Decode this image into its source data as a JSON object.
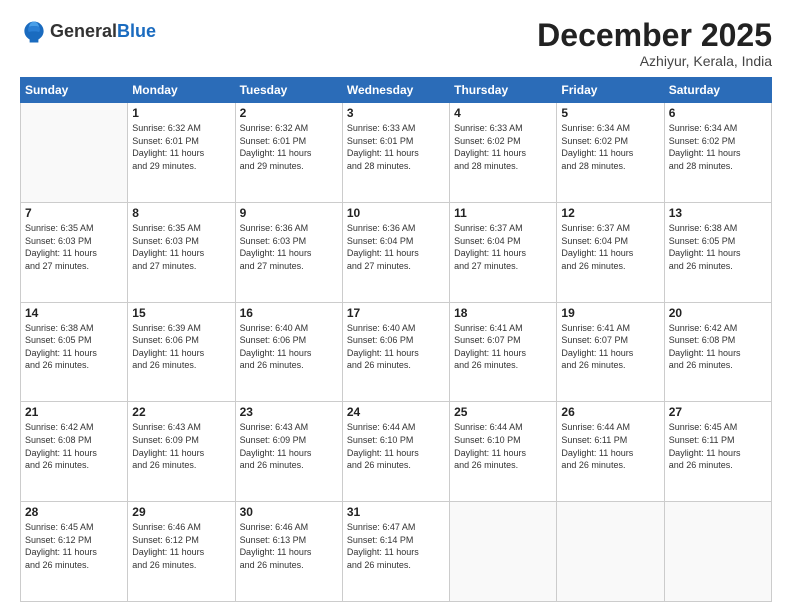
{
  "logo": {
    "general": "General",
    "blue": "Blue"
  },
  "header": {
    "month": "December 2025",
    "location": "Azhiyur, Kerala, India"
  },
  "weekdays": [
    "Sunday",
    "Monday",
    "Tuesday",
    "Wednesday",
    "Thursday",
    "Friday",
    "Saturday"
  ],
  "weeks": [
    [
      {
        "day": "",
        "info": ""
      },
      {
        "day": "1",
        "info": "Sunrise: 6:32 AM\nSunset: 6:01 PM\nDaylight: 11 hours\nand 29 minutes."
      },
      {
        "day": "2",
        "info": "Sunrise: 6:32 AM\nSunset: 6:01 PM\nDaylight: 11 hours\nand 29 minutes."
      },
      {
        "day": "3",
        "info": "Sunrise: 6:33 AM\nSunset: 6:01 PM\nDaylight: 11 hours\nand 28 minutes."
      },
      {
        "day": "4",
        "info": "Sunrise: 6:33 AM\nSunset: 6:02 PM\nDaylight: 11 hours\nand 28 minutes."
      },
      {
        "day": "5",
        "info": "Sunrise: 6:34 AM\nSunset: 6:02 PM\nDaylight: 11 hours\nand 28 minutes."
      },
      {
        "day": "6",
        "info": "Sunrise: 6:34 AM\nSunset: 6:02 PM\nDaylight: 11 hours\nand 28 minutes."
      }
    ],
    [
      {
        "day": "7",
        "info": "Sunrise: 6:35 AM\nSunset: 6:03 PM\nDaylight: 11 hours\nand 27 minutes."
      },
      {
        "day": "8",
        "info": "Sunrise: 6:35 AM\nSunset: 6:03 PM\nDaylight: 11 hours\nand 27 minutes."
      },
      {
        "day": "9",
        "info": "Sunrise: 6:36 AM\nSunset: 6:03 PM\nDaylight: 11 hours\nand 27 minutes."
      },
      {
        "day": "10",
        "info": "Sunrise: 6:36 AM\nSunset: 6:04 PM\nDaylight: 11 hours\nand 27 minutes."
      },
      {
        "day": "11",
        "info": "Sunrise: 6:37 AM\nSunset: 6:04 PM\nDaylight: 11 hours\nand 27 minutes."
      },
      {
        "day": "12",
        "info": "Sunrise: 6:37 AM\nSunset: 6:04 PM\nDaylight: 11 hours\nand 26 minutes."
      },
      {
        "day": "13",
        "info": "Sunrise: 6:38 AM\nSunset: 6:05 PM\nDaylight: 11 hours\nand 26 minutes."
      }
    ],
    [
      {
        "day": "14",
        "info": "Sunrise: 6:38 AM\nSunset: 6:05 PM\nDaylight: 11 hours\nand 26 minutes."
      },
      {
        "day": "15",
        "info": "Sunrise: 6:39 AM\nSunset: 6:06 PM\nDaylight: 11 hours\nand 26 minutes."
      },
      {
        "day": "16",
        "info": "Sunrise: 6:40 AM\nSunset: 6:06 PM\nDaylight: 11 hours\nand 26 minutes."
      },
      {
        "day": "17",
        "info": "Sunrise: 6:40 AM\nSunset: 6:06 PM\nDaylight: 11 hours\nand 26 minutes."
      },
      {
        "day": "18",
        "info": "Sunrise: 6:41 AM\nSunset: 6:07 PM\nDaylight: 11 hours\nand 26 minutes."
      },
      {
        "day": "19",
        "info": "Sunrise: 6:41 AM\nSunset: 6:07 PM\nDaylight: 11 hours\nand 26 minutes."
      },
      {
        "day": "20",
        "info": "Sunrise: 6:42 AM\nSunset: 6:08 PM\nDaylight: 11 hours\nand 26 minutes."
      }
    ],
    [
      {
        "day": "21",
        "info": "Sunrise: 6:42 AM\nSunset: 6:08 PM\nDaylight: 11 hours\nand 26 minutes."
      },
      {
        "day": "22",
        "info": "Sunrise: 6:43 AM\nSunset: 6:09 PM\nDaylight: 11 hours\nand 26 minutes."
      },
      {
        "day": "23",
        "info": "Sunrise: 6:43 AM\nSunset: 6:09 PM\nDaylight: 11 hours\nand 26 minutes."
      },
      {
        "day": "24",
        "info": "Sunrise: 6:44 AM\nSunset: 6:10 PM\nDaylight: 11 hours\nand 26 minutes."
      },
      {
        "day": "25",
        "info": "Sunrise: 6:44 AM\nSunset: 6:10 PM\nDaylight: 11 hours\nand 26 minutes."
      },
      {
        "day": "26",
        "info": "Sunrise: 6:44 AM\nSunset: 6:11 PM\nDaylight: 11 hours\nand 26 minutes."
      },
      {
        "day": "27",
        "info": "Sunrise: 6:45 AM\nSunset: 6:11 PM\nDaylight: 11 hours\nand 26 minutes."
      }
    ],
    [
      {
        "day": "28",
        "info": "Sunrise: 6:45 AM\nSunset: 6:12 PM\nDaylight: 11 hours\nand 26 minutes."
      },
      {
        "day": "29",
        "info": "Sunrise: 6:46 AM\nSunset: 6:12 PM\nDaylight: 11 hours\nand 26 minutes."
      },
      {
        "day": "30",
        "info": "Sunrise: 6:46 AM\nSunset: 6:13 PM\nDaylight: 11 hours\nand 26 minutes."
      },
      {
        "day": "31",
        "info": "Sunrise: 6:47 AM\nSunset: 6:14 PM\nDaylight: 11 hours\nand 26 minutes."
      },
      {
        "day": "",
        "info": ""
      },
      {
        "day": "",
        "info": ""
      },
      {
        "day": "",
        "info": ""
      }
    ]
  ]
}
